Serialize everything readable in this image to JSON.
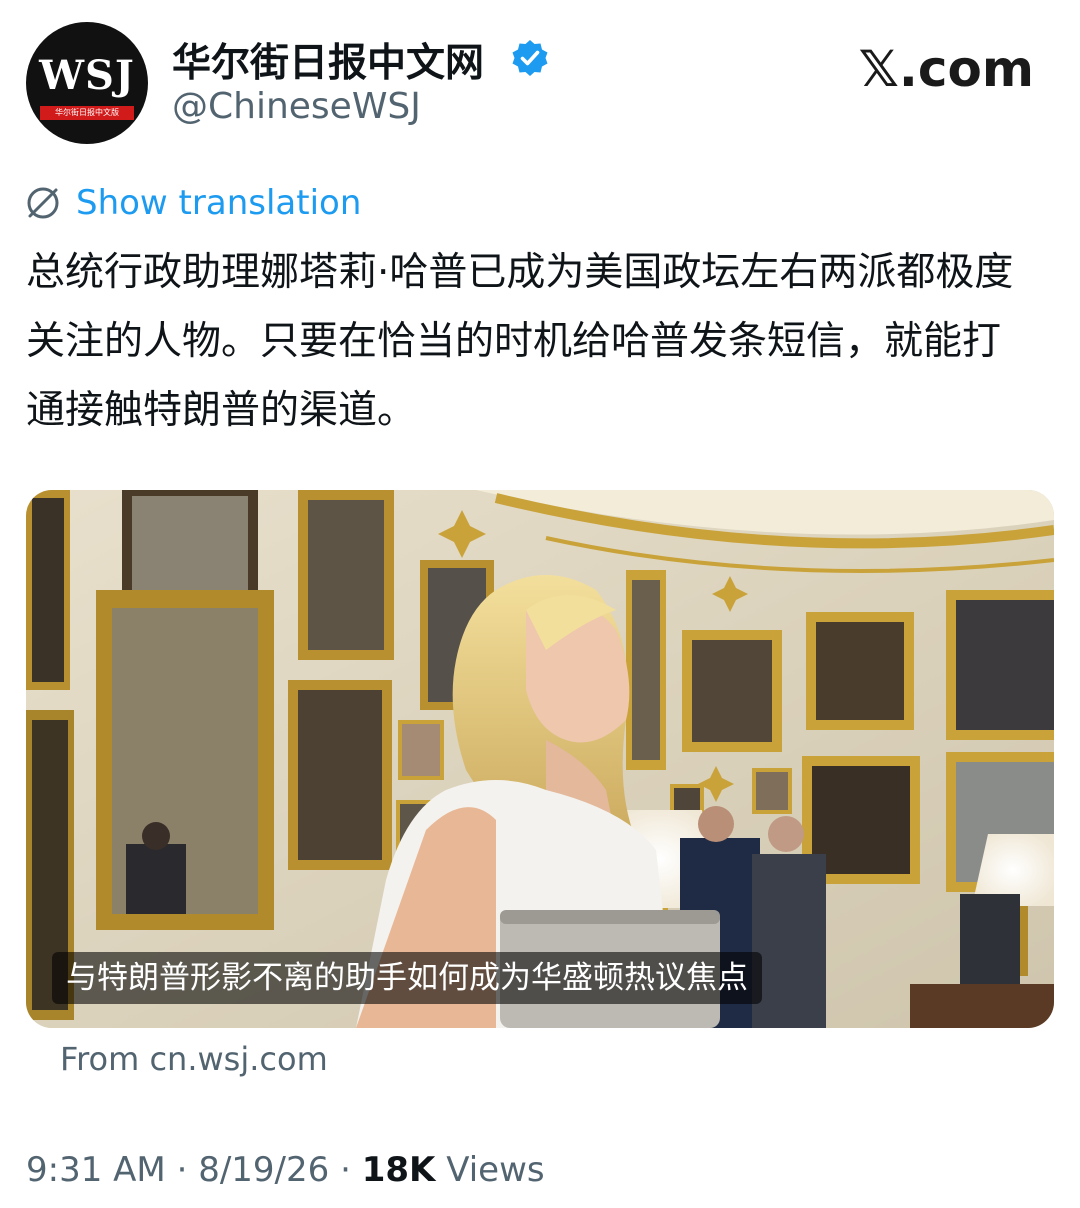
{
  "account": {
    "avatar_text": "WSJ",
    "avatar_banner": "华尔街日报中文版",
    "name": "华尔街日报中文网",
    "handle": "@ChineseWSJ",
    "verified_icon": "verified-badge-icon"
  },
  "site_mark": "𝕏.com",
  "translation": {
    "icon": "translate-icon",
    "label": "Show translation"
  },
  "tweet": {
    "text": "总统行政助理娜塔莉·哈普已成为美国政坛左右两派都极度关注的人物。只要在恰当的时机给哈普发条短信，就能打通接触特朗普的渠道。"
  },
  "media_card": {
    "caption": "与特朗普形影不离的助手如何成为华盛顿热议焦点",
    "source": "From cn.wsj.com"
  },
  "meta": {
    "time": "9:31 AM",
    "separator": "·",
    "date": "8/19/26",
    "views_count": "18K",
    "views_label": "Views"
  },
  "colors": {
    "accent": "#1d9bf0",
    "text_primary": "#0f1419",
    "text_secondary": "#536471",
    "verified": "#1d9bf0"
  }
}
